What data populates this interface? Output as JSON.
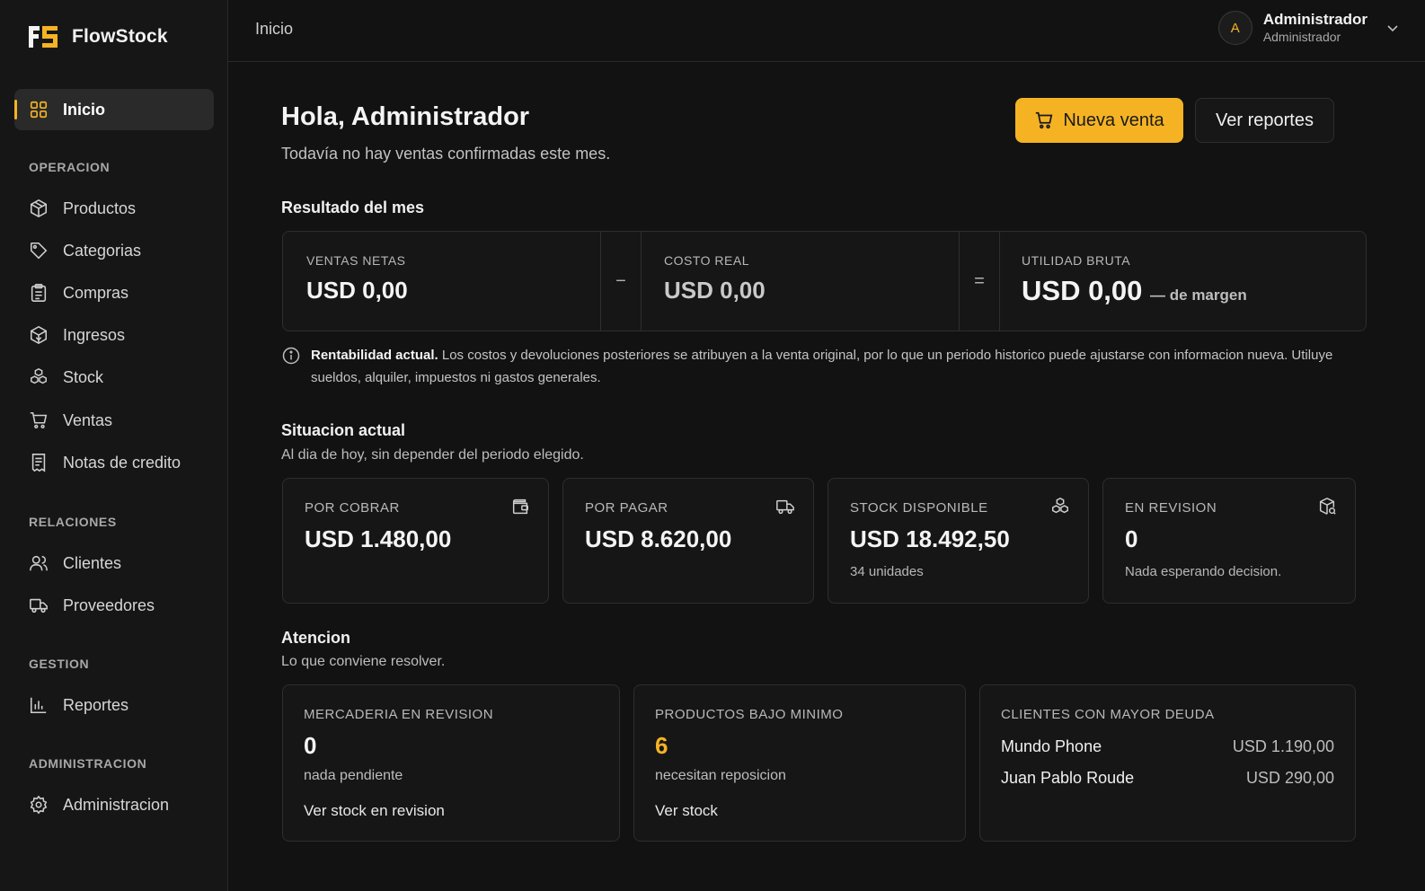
{
  "brand": {
    "logo_text": "FS",
    "name": "FlowStock"
  },
  "sidebar": {
    "active": {
      "label": "Inicio",
      "icon": "grid-icon"
    },
    "sections": [
      {
        "title": "OPERACION",
        "items": [
          {
            "label": "Productos",
            "icon": "package-icon"
          },
          {
            "label": "Categorias",
            "icon": "tag-icon"
          },
          {
            "label": "Compras",
            "icon": "clipboard-icon"
          },
          {
            "label": "Ingresos",
            "icon": "box-in-icon"
          },
          {
            "label": "Stock",
            "icon": "boxes-icon"
          },
          {
            "label": "Ventas",
            "icon": "cart-icon"
          },
          {
            "label": "Notas de credito",
            "icon": "receipt-icon"
          }
        ]
      },
      {
        "title": "RELACIONES",
        "items": [
          {
            "label": "Clientes",
            "icon": "users-icon"
          },
          {
            "label": "Proveedores",
            "icon": "truck-icon"
          }
        ]
      },
      {
        "title": "GESTION",
        "items": [
          {
            "label": "Reportes",
            "icon": "bar-chart-icon"
          }
        ]
      },
      {
        "title": "ADMINISTRACION",
        "items": [
          {
            "label": "Administracion",
            "icon": "gear-icon"
          }
        ]
      }
    ]
  },
  "topbar": {
    "title": "Inicio",
    "user": {
      "initial": "A",
      "name": "Administrador",
      "role": "Administrador"
    }
  },
  "header": {
    "greeting": "Hola, Administrador",
    "subtitle": "Todavía no hay ventas confirmadas este mes.",
    "primary_button": "Nueva venta",
    "secondary_button": "Ver reportes"
  },
  "result": {
    "title": "Resultado del mes",
    "net_sales_label": "VENTAS NETAS",
    "net_sales_value": "USD 0,00",
    "minus": "−",
    "real_cost_label": "COSTO REAL",
    "real_cost_value": "USD 0,00",
    "equals": "=",
    "gross_profit_label": "UTILIDAD BRUTA",
    "gross_profit_value": "USD 0,00",
    "margin": "— de margen",
    "info_bold": "Rentabilidad actual.",
    "info_text": " Los costos y devoluciones posteriores se atribuyen a la venta original, por lo que un periodo historico puede ajustarse con informacion nueva. Utiluye sueldos, alquiler, impuestos ni gastos generales."
  },
  "current": {
    "title": "Situacion actual",
    "subtitle": "Al dia de hoy, sin depender del periodo elegido.",
    "cards": [
      {
        "label": "POR COBRAR",
        "value": "USD 1.480,00",
        "note": "",
        "icon": "wallet-icon"
      },
      {
        "label": "POR PAGAR",
        "value": "USD 8.620,00",
        "note": "",
        "icon": "truck-icon"
      },
      {
        "label": "STOCK DISPONIBLE",
        "value": "USD 18.492,50",
        "note": "34 unidades",
        "icon": "boxes-icon"
      },
      {
        "label": "EN REVISION",
        "value": "0",
        "note": "Nada esperando decision.",
        "icon": "box-search-icon"
      }
    ]
  },
  "attention": {
    "title": "Atencion",
    "subtitle": "Lo que conviene resolver.",
    "review": {
      "label": "MERCADERIA EN REVISION",
      "value": "0",
      "note": "nada pendiente",
      "link": "Ver stock en revision"
    },
    "below_min": {
      "label": "PRODUCTOS BAJO MINIMO",
      "value": "6",
      "note": "necesitan reposicion",
      "link": "Ver stock"
    },
    "debtors": {
      "label": "CLIENTES CON MAYOR DEUDA",
      "rows": [
        {
          "name": "Mundo Phone",
          "amount": "USD 1.190,00"
        },
        {
          "name": "Juan Pablo Roude",
          "amount": "USD 290,00"
        }
      ]
    }
  },
  "colors": {
    "accent": "#f5b324",
    "background": "#121212",
    "card": "#161616",
    "border": "#2e2e2e"
  }
}
